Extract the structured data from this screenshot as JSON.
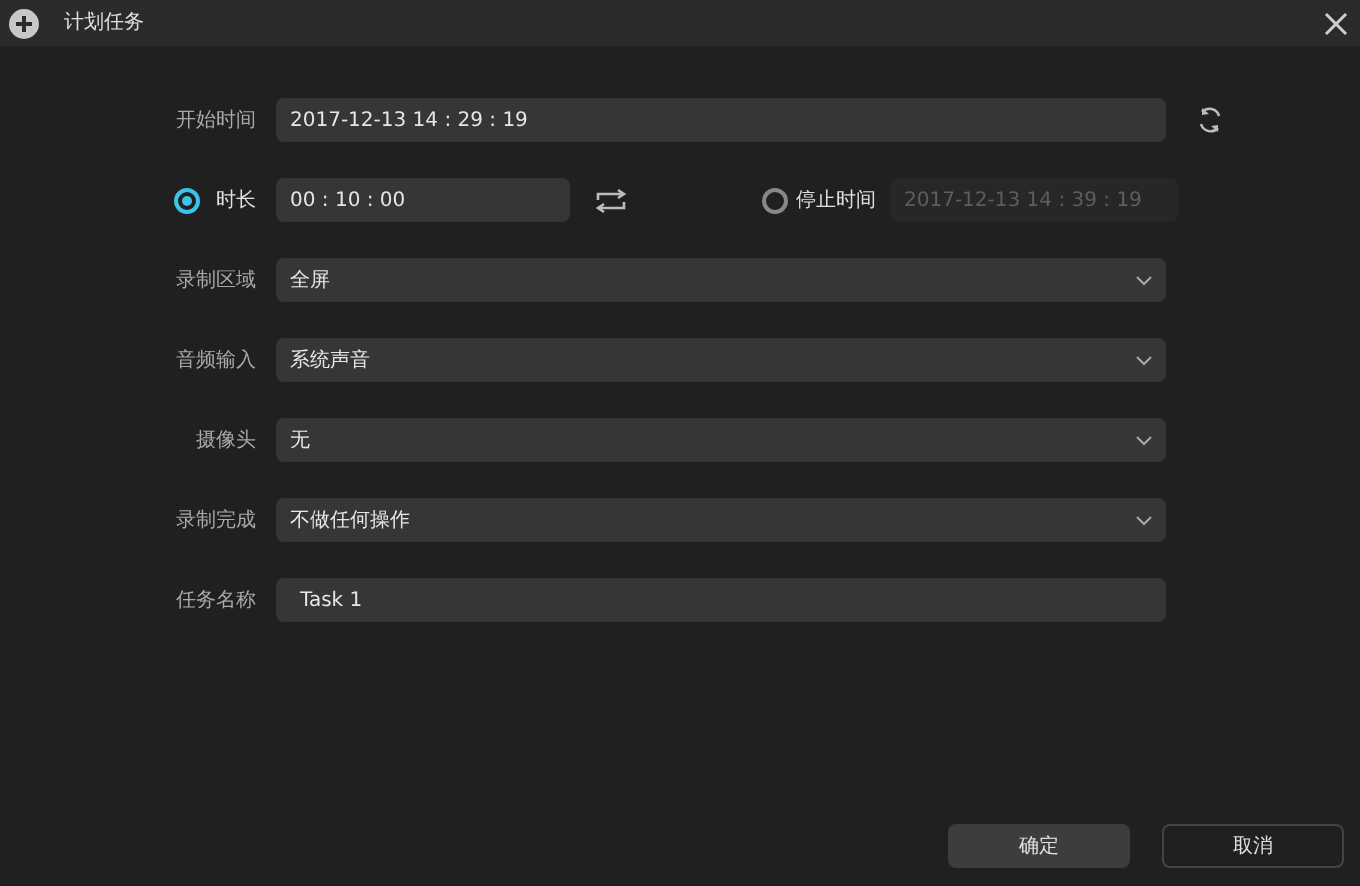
{
  "window": {
    "title": "计划任务"
  },
  "start_time": {
    "label": "开始时间",
    "value": "2017-12-13 14 : 29 : 19"
  },
  "modes": [
    {
      "label": "时长",
      "selected": true,
      "value": "00 : 10 : 00"
    },
    {
      "label": "停止时间",
      "selected": false,
      "value": "2017-12-13 14 : 39 : 19"
    }
  ],
  "selects": [
    {
      "label": "录制区域",
      "value": "全屏"
    },
    {
      "label": "音频输入",
      "value": "系统声音"
    },
    {
      "label": "摄像头",
      "value": "无"
    },
    {
      "label": "录制完成",
      "value": "不做任何操作"
    }
  ],
  "task_name": {
    "label": "任务名称",
    "value": "Task 1"
  },
  "buttons": [
    {
      "label": "确定",
      "kind": "primary"
    },
    {
      "label": "取消",
      "kind": "secondary"
    }
  ]
}
